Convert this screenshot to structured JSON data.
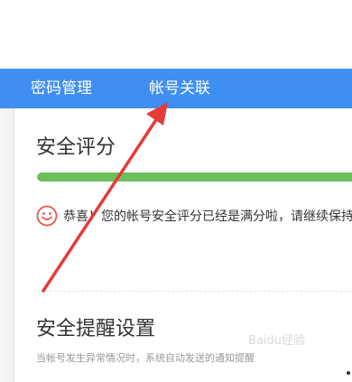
{
  "nav": {
    "tabs": [
      {
        "label": "密码管理"
      },
      {
        "label": "帐号关联"
      }
    ],
    "active_index": 1
  },
  "security_score": {
    "title": "安全评分",
    "progress": 1.0,
    "congrats_text": "恭喜！您的帐号安全评分已经是满分啦，请继续保持！"
  },
  "security_alert": {
    "title": "安全提醒设置",
    "hint": "当帐号发生异常情况时，系统自动发送的通知提醒"
  },
  "watermark": "Baidu经验",
  "colors": {
    "nav_bg": "#3f8ff0",
    "progress_fill": "#6cc05a",
    "smile": "#e8564e",
    "arrow": "#e43c37"
  },
  "icons": {
    "smile": "smile-icon"
  }
}
